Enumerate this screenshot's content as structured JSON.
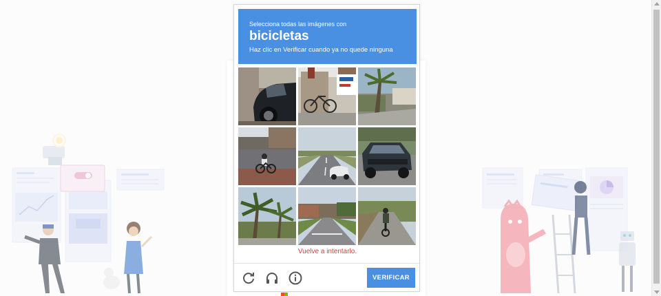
{
  "challenge": {
    "instruction_line1": "Selecciona todas las imágenes con",
    "target_word": "bicicletas",
    "instruction_line3": "Haz clic en Verificar cuando ya no quede ninguna"
  },
  "tiles": [
    {
      "icon": "street-tile-car"
    },
    {
      "icon": "street-tile-bicycle-building"
    },
    {
      "icon": "street-tile-palm-street"
    },
    {
      "icon": "street-tile-cyclist-road"
    },
    {
      "icon": "street-tile-highway"
    },
    {
      "icon": "street-tile-jeep"
    },
    {
      "icon": "street-tile-palm-trees"
    },
    {
      "icon": "street-tile-suburban-road"
    },
    {
      "icon": "street-tile-cyclist-path"
    }
  ],
  "error_message": "Vuelve a intentarlo.",
  "footer": {
    "reload_icon": "reload-icon",
    "audio_icon": "headphones-icon",
    "info_icon": "info-icon",
    "verify_label": "VERIFICAR"
  },
  "colors": {
    "brand_blue": "#4a90e2",
    "error_red": "#d0443a"
  }
}
